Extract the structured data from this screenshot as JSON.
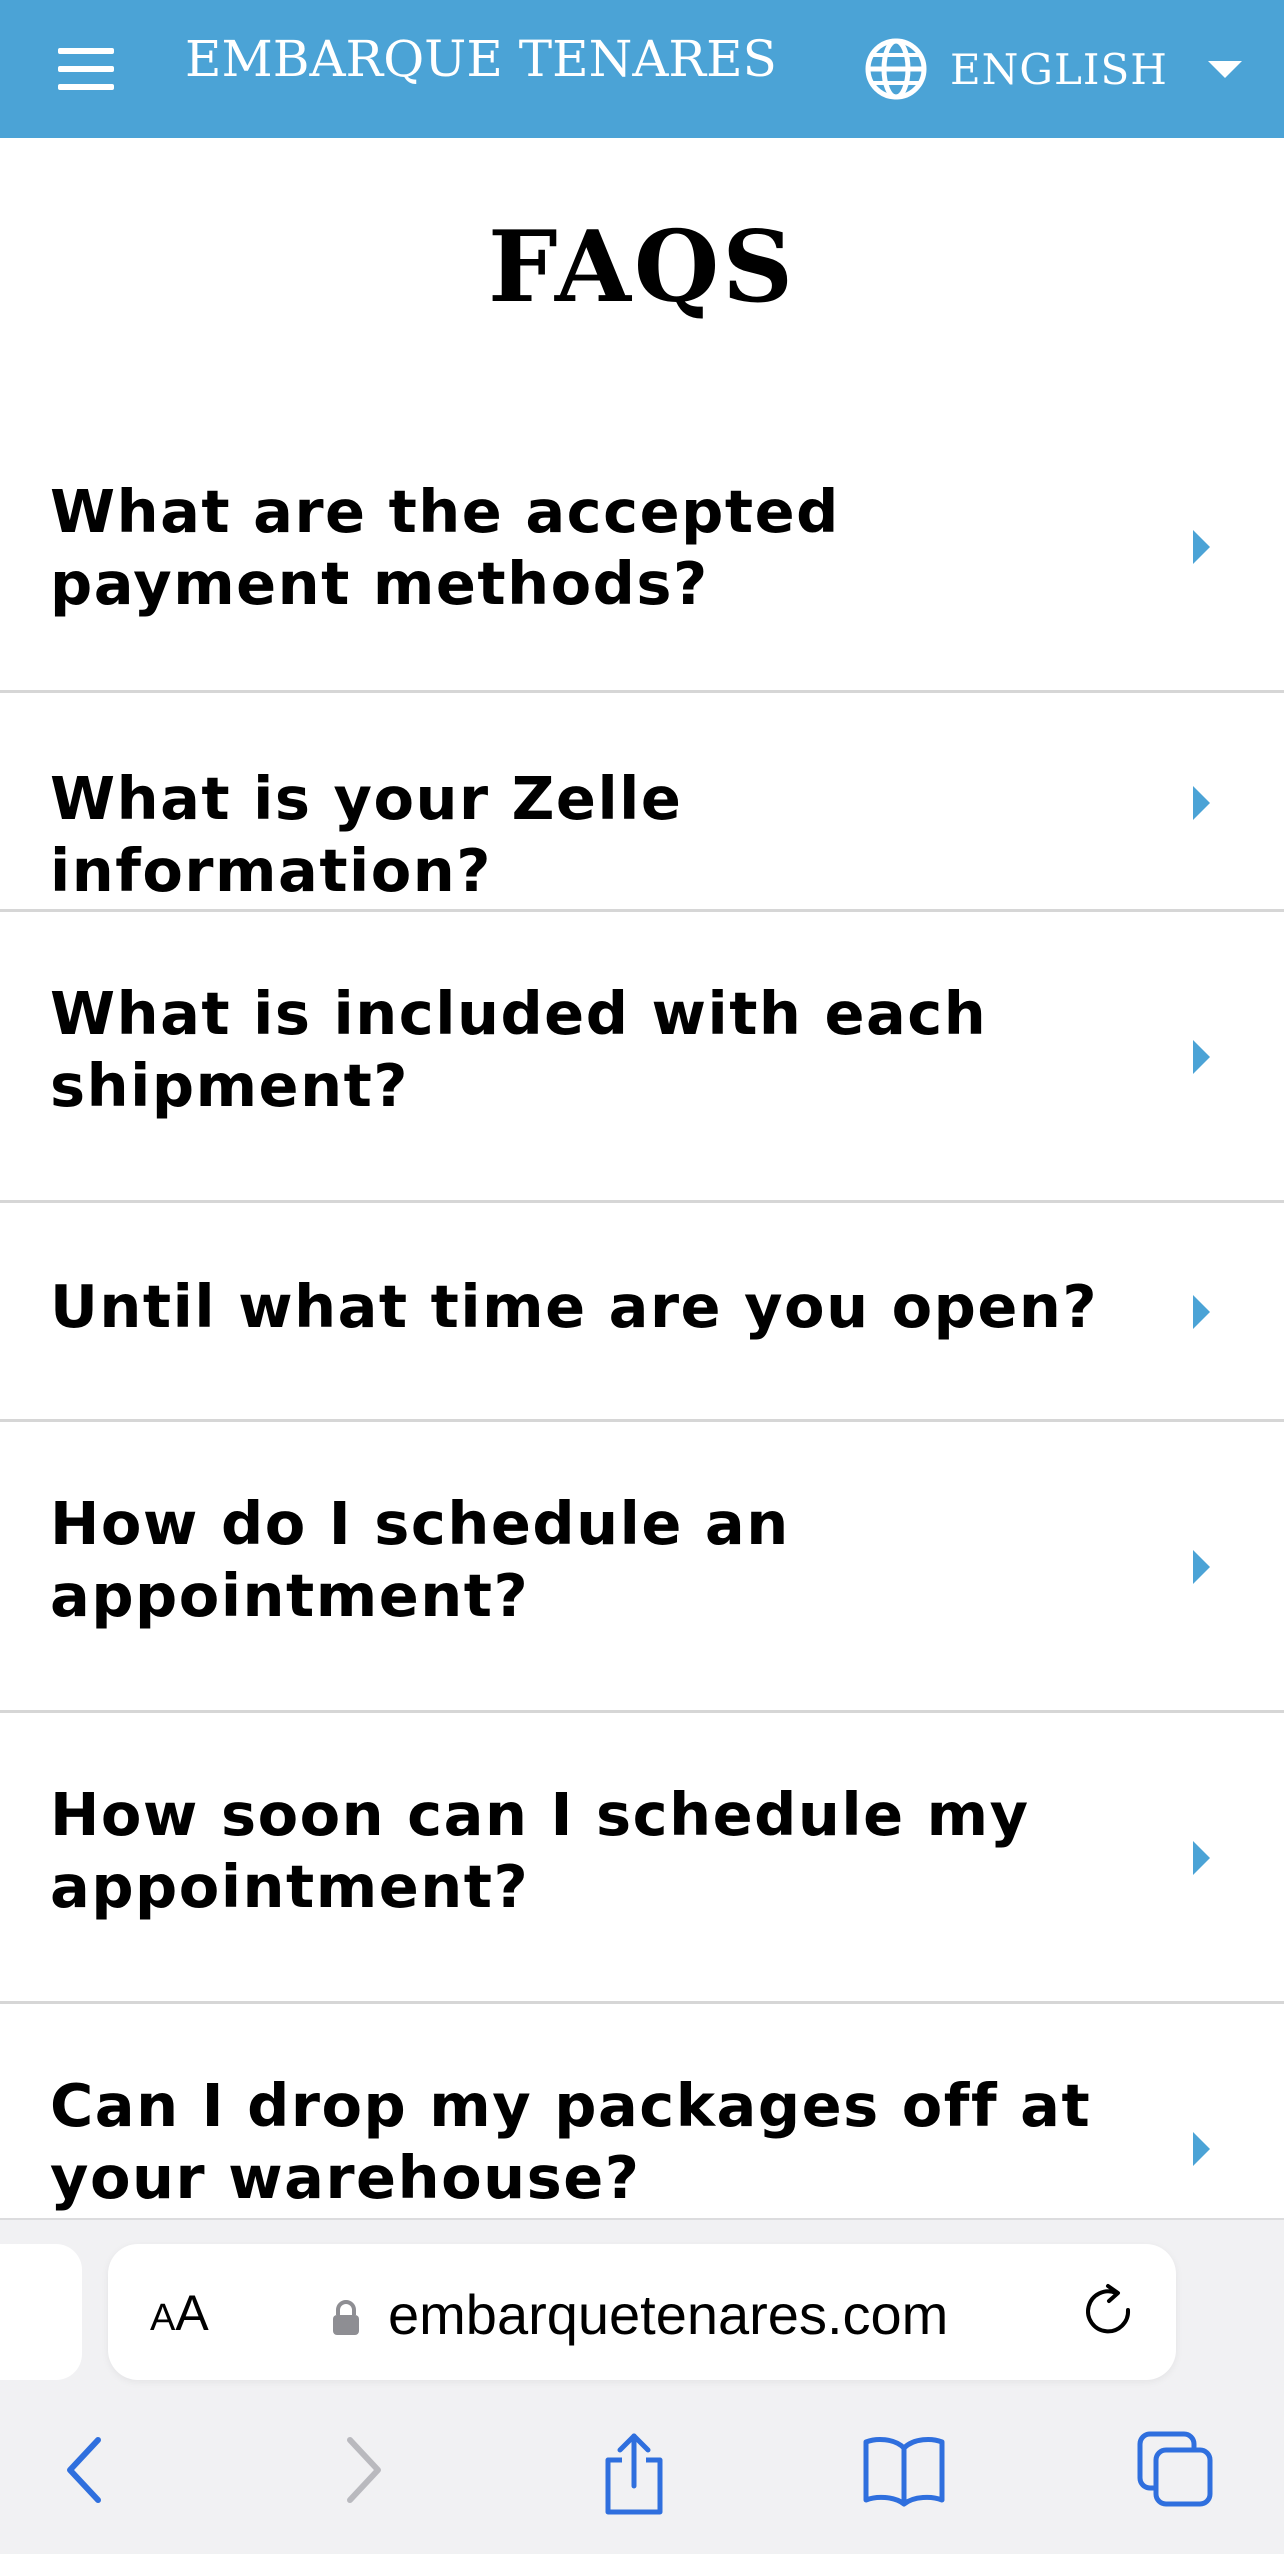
{
  "header": {
    "brand": "EMBARQUE TENARES",
    "language": "ENGLISH",
    "background_color": "#4ba3d6",
    "menu_icon": "hamburger-menu-icon",
    "language_icon": "globe-icon",
    "dropdown_icon": "caret-down-icon"
  },
  "main": {
    "title": "FAQS",
    "faqs": [
      {
        "question": "What are the accepted payment methods?"
      },
      {
        "question": "What is your Zelle information?"
      },
      {
        "question": "What is included with each shipment?"
      },
      {
        "question": "Until what time are you open?"
      },
      {
        "question": "How do I schedule an appointment?"
      },
      {
        "question": "How soon can I schedule my appointment?"
      },
      {
        "question": "Can I drop my packages off at your warehouse?"
      }
    ],
    "arrow_color": "#4ba3d6"
  },
  "browser": {
    "text_size_label_small": "A",
    "text_size_label_big": "A",
    "url": "embarquetenares.com",
    "icons": [
      "lock-icon",
      "reload-icon",
      "back-icon",
      "forward-icon",
      "share-icon",
      "bookmarks-icon",
      "tabs-icon"
    ],
    "accent_color": "#2f6fde"
  }
}
